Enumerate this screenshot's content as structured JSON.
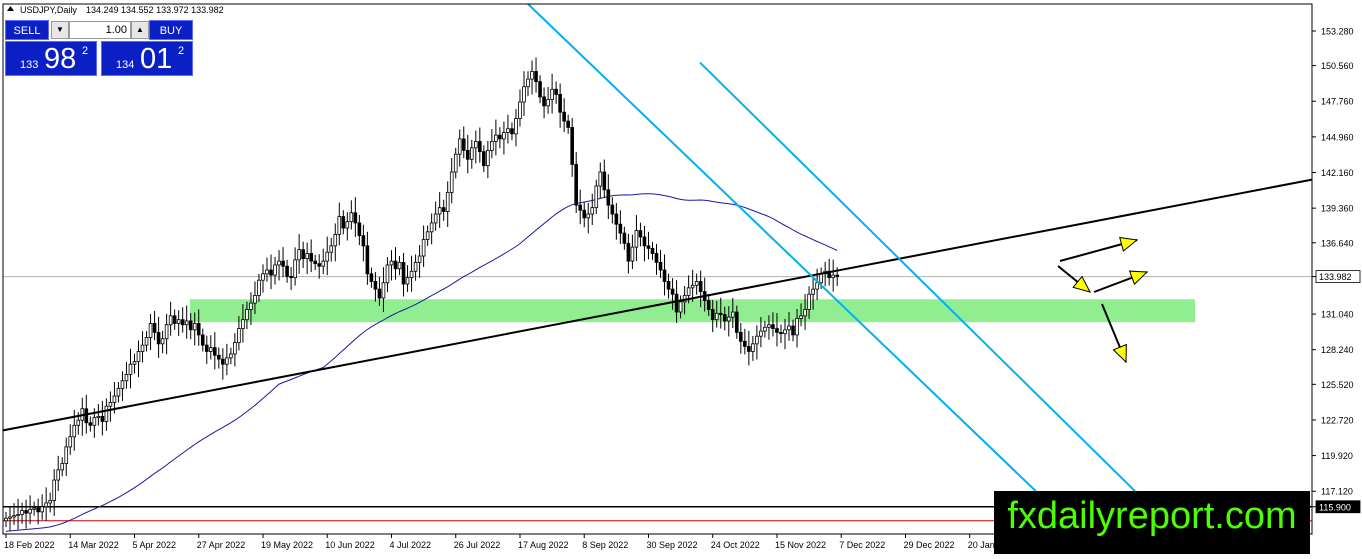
{
  "header": {
    "symbol": "USDJPY,Daily",
    "ohlc": "134.249 134.552 133.972 133.982"
  },
  "trade_panel": {
    "sell_label": "SELL",
    "buy_label": "BUY",
    "lot": "1.00",
    "bid_prefix": "133",
    "bid_big": "98",
    "bid_sup": "2",
    "ask_prefix": "134",
    "ask_big": "01",
    "ask_sup": "2"
  },
  "watermark": "fxdailyreport.com",
  "chart_data": {
    "type": "candlestick",
    "ylim": [
      113.76,
      155.4
    ],
    "y_ticks": [
      "153.280",
      "150.560",
      "147.760",
      "144.960",
      "142.160",
      "139.360",
      "136.640",
      "133.982",
      "131.040",
      "128.240",
      "125.520",
      "122.720",
      "119.920",
      "117.120",
      "115.900"
    ],
    "y_tick_values": [
      153.28,
      150.56,
      147.76,
      144.96,
      142.16,
      139.36,
      136.64,
      133.982,
      131.04,
      128.24,
      125.52,
      122.72,
      119.92,
      117.12,
      115.9
    ],
    "price_marker": {
      "label": "133.982",
      "value": 133.982,
      "bg": "#ffffff",
      "fg": "#000000"
    },
    "support_marker": {
      "label": "115.900",
      "value": 115.9,
      "bg": "#000000",
      "fg": "#ffffff"
    },
    "x_labels": [
      "18 Feb 2022",
      "14 Mar 2022",
      "5 Apr 2022",
      "27 Apr 2022",
      "19 May 2022",
      "10 Jun 2022",
      "4 Jul 2022",
      "26 Jul 2022",
      "17 Aug 2022",
      "8 Sep 2022",
      "30 Sep 2022",
      "24 Oct 2022",
      "15 Nov 2022",
      "7 Dec 2022",
      "29 Dec 2022",
      "20 Jan"
    ],
    "x_label_index": [
      0,
      16,
      32,
      48,
      64,
      80,
      96,
      112,
      128,
      144,
      160,
      176,
      192,
      208,
      224,
      240
    ],
    "x_index_range": [
      0,
      259
    ],
    "closes": [
      115.0,
      115.1,
      115.2,
      115.3,
      115.6,
      115.4,
      115.7,
      115.8,
      115.5,
      115.9,
      116.2,
      116.4,
      118.0,
      118.8,
      119.3,
      120.6,
      121.4,
      122.3,
      122.7,
      123.6,
      122.5,
      122.3,
      122.9,
      123.0,
      122.6,
      123.8,
      124.1,
      124.6,
      125.2,
      125.8,
      126.3,
      127.1,
      127.3,
      128.1,
      128.6,
      129.2,
      130.3,
      129.6,
      128.7,
      129.1,
      130.2,
      130.9,
      130.3,
      130.6,
      130.2,
      130.5,
      129.8,
      130.3,
      129.4,
      128.6,
      128.1,
      128.4,
      127.8,
      127.5,
      127.1,
      127.6,
      127.9,
      128.8,
      129.9,
      130.6,
      131.4,
      131.9,
      132.5,
      133.7,
      134.2,
      134.5,
      134.1,
      134.9,
      135.2,
      134.8,
      134.0,
      133.9,
      135.3,
      136.1,
      135.4,
      135.8,
      135.2,
      135.0,
      134.8,
      135.2,
      135.9,
      136.4,
      137.3,
      138.7,
      137.8,
      138.3,
      139.0,
      138.2,
      137.2,
      136.4,
      134.2,
      133.6,
      133.0,
      132.3,
      133.5,
      134.9,
      135.2,
      134.6,
      135.1,
      133.4,
      133.9,
      134.4,
      135.1,
      135.6,
      136.9,
      137.5,
      138.2,
      138.9,
      139.4,
      139.1,
      140.6,
      142.2,
      143.6,
      144.8,
      143.9,
      143.2,
      144.1,
      144.6,
      143.8,
      142.7,
      143.9,
      144.6,
      145.1,
      144.8,
      145.3,
      145.6,
      145.2,
      146.4,
      147.7,
      148.9,
      149.5,
      150.1,
      149.3,
      148.1,
      147.4,
      147.9,
      148.7,
      148.3,
      146.9,
      146.2,
      145.7,
      142.8,
      139.6,
      139.2,
      138.6,
      138.9,
      139.4,
      141.1,
      142.2,
      140.8,
      139.6,
      138.9,
      138.1,
      137.4,
      136.6,
      135.2,
      136.3,
      137.6,
      137.1,
      136.4,
      136.2,
      135.8,
      135.1,
      134.5,
      133.6,
      133.0,
      132.6,
      131.2,
      132.0,
      132.5,
      133.1,
      133.3,
      133.6,
      132.8,
      132.1,
      131.4,
      130.6,
      131.1,
      131.0,
      130.5,
      130.8,
      131.2,
      129.6,
      128.9,
      128.5,
      128.1,
      128.7,
      129.3,
      129.7,
      130.0,
      130.2,
      129.9,
      129.6,
      129.5,
      129.8,
      130.1,
      129.4,
      130.7,
      130.9,
      131.4,
      132.6,
      133.0,
      133.5,
      134.2,
      134.4,
      133.9,
      134.1,
      133.982
    ]
  },
  "colors": {
    "candle": "#000000",
    "channel": "#00b0f0",
    "trendline": "#000000",
    "ma": "#1a1aa0",
    "zone": "#90ee90",
    "arrow_fill": "#ffff00",
    "panel_blue": "#0a20c4",
    "watermark_text": "#4cff00",
    "support_red": "#cc0000"
  }
}
